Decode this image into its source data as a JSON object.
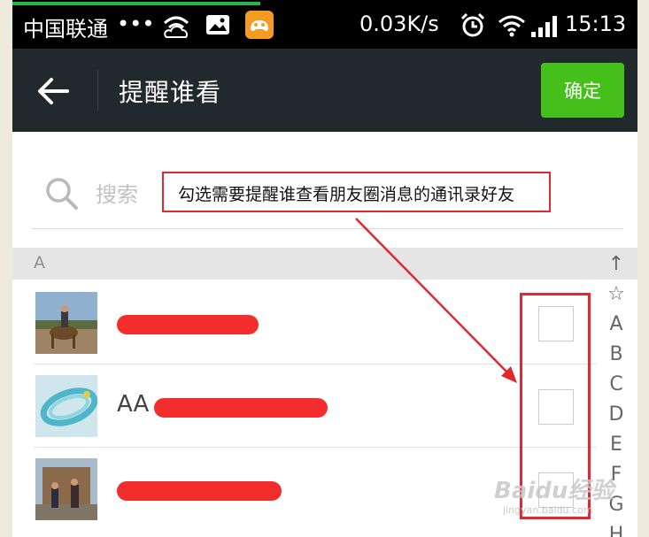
{
  "status_bar": {
    "carrier": "中国联通",
    "dots": "•••",
    "speed": "0.03K/s",
    "time": "15:13",
    "icons": [
      "wifi-cloud-icon",
      "image-icon",
      "game-app-icon",
      "alarm-icon",
      "wifi-icon",
      "signal-icon"
    ]
  },
  "title_bar": {
    "title": "提醒谁看",
    "confirm_label": "确定"
  },
  "search": {
    "placeholder": "搜索"
  },
  "section": {
    "letter": "A"
  },
  "contacts": [
    {
      "name": "",
      "checked": false
    },
    {
      "name": "AA",
      "checked": false
    },
    {
      "name": "",
      "checked": false
    }
  ],
  "index_bar": [
    "↑",
    "☆",
    "A",
    "B",
    "C",
    "D",
    "E",
    "F",
    "G",
    "H"
  ],
  "annotation": {
    "text": "勾选需要提醒谁查看朋友圈消息的通讯录好友"
  },
  "watermark": {
    "text": "Baidu经验",
    "sub": "jingyan.baidu.com"
  },
  "colors": {
    "title_bar_bg": "#22292c",
    "confirm_bg": "#45c01a",
    "annotation_red": "#e0282e",
    "redaction_red": "#f21a1a"
  }
}
